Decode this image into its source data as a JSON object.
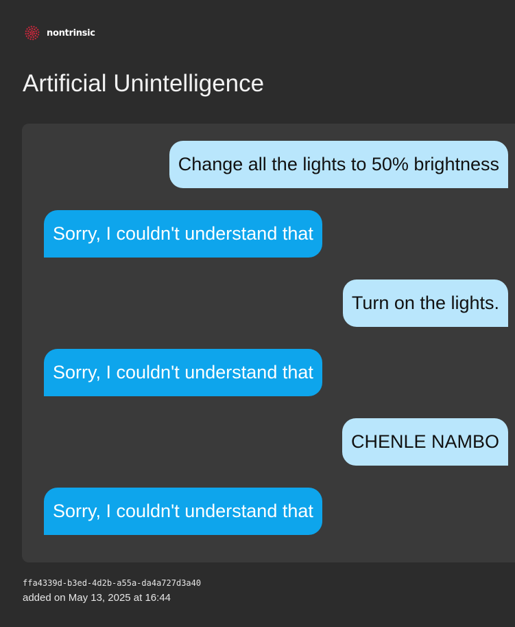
{
  "brand": {
    "name": "nontrinsic",
    "logo_icon": "dotted-circle-logo-icon",
    "logo_color": "#c8283c"
  },
  "page": {
    "title": "Artificial Unintelligence"
  },
  "conversation": {
    "messages": [
      {
        "role": "user",
        "text": "Change all the lights to 50% brightness"
      },
      {
        "role": "assistant",
        "text": "Sorry, I couldn't understand that"
      },
      {
        "role": "user",
        "text": "Turn on the lights."
      },
      {
        "role": "assistant",
        "text": "Sorry, I couldn't understand that"
      },
      {
        "role": "user",
        "text": "CHENLE NAMBO"
      },
      {
        "role": "assistant",
        "text": "Sorry, I couldn't understand that"
      }
    ]
  },
  "meta": {
    "id": "ffa4339d-b3ed-4d2b-a55a-da4a727d3a40",
    "added": "added on May 13, 2025 at 16:44"
  },
  "colors": {
    "background": "#2c2c2c",
    "panel": "#3a3a3a",
    "user_bubble": "#b9e6fc",
    "assistant_bubble": "#0ea5ec"
  }
}
